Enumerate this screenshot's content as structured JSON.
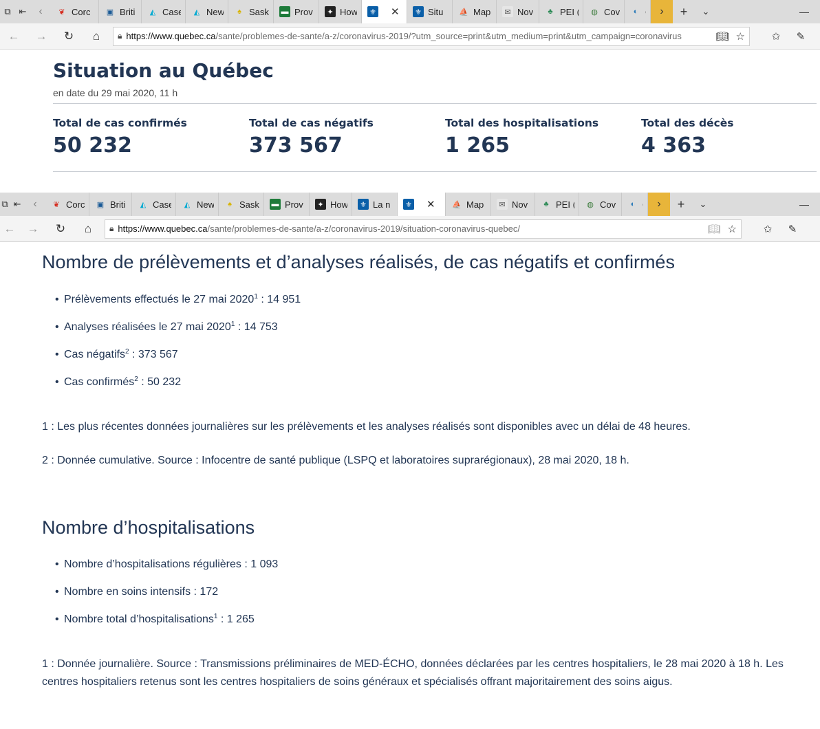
{
  "window1": {
    "tabs": [
      {
        "label": "Corc",
        "icon": "maple-leaf-icon",
        "active": false
      },
      {
        "label": "Briti",
        "icon": "bc-gov-icon",
        "active": false
      },
      {
        "label": "Case",
        "icon": "alberta-icon",
        "active": false
      },
      {
        "label": "New",
        "icon": "alberta-icon",
        "active": false
      },
      {
        "label": "Sask",
        "icon": "sask-icon",
        "active": false
      },
      {
        "label": "Prov",
        "icon": "manitoba-icon",
        "active": false
      },
      {
        "label": "How",
        "icon": "ontario-icon",
        "active": false
      },
      {
        "label": "",
        "icon": "quebec-fleur-icon",
        "active": true
      },
      {
        "label": "Situ",
        "icon": "quebec-fleur-icon",
        "active": false
      },
      {
        "label": "Map",
        "icon": "nb-icon",
        "active": false
      },
      {
        "label": "Nov",
        "icon": "ns-icon",
        "active": false
      },
      {
        "label": "PEI (",
        "icon": "pei-icon",
        "active": false
      },
      {
        "label": "Cov",
        "icon": "globe-icon",
        "active": false
      },
      {
        "label": "C",
        "icon": "nl-icon",
        "active": false
      }
    ],
    "url_domain": "https://www.quebec.ca",
    "url_path": "/sante/problemes-de-sante/a-z/coronavirus-2019/?utm_source=print&utm_medium=print&utm_campaign=coronavirus"
  },
  "situation": {
    "title": "Situation au Québec",
    "date": "en date du 29 mai 2020, 11 h",
    "stats": [
      {
        "label": "Total de cas confirmés",
        "value": "50 232"
      },
      {
        "label": "Total de cas négatifs",
        "value": "373 567"
      },
      {
        "label": "Total des hospitalisations",
        "value": "1 265"
      },
      {
        "label": "Total des décès",
        "value": "4 363"
      }
    ]
  },
  "window2": {
    "tabs": [
      {
        "label": "Corc",
        "icon": "maple-leaf-icon",
        "active": false
      },
      {
        "label": "Briti",
        "icon": "bc-gov-icon",
        "active": false
      },
      {
        "label": "Case",
        "icon": "alberta-icon",
        "active": false
      },
      {
        "label": "New",
        "icon": "alberta-icon",
        "active": false
      },
      {
        "label": "Sask",
        "icon": "sask-icon",
        "active": false
      },
      {
        "label": "Prov",
        "icon": "manitoba-icon",
        "active": false
      },
      {
        "label": "How",
        "icon": "ontario-icon",
        "active": false
      },
      {
        "label": "La n",
        "icon": "quebec-fleur-icon",
        "active": false
      },
      {
        "label": "",
        "icon": "quebec-fleur-icon",
        "active": true
      },
      {
        "label": "Map",
        "icon": "nb-icon",
        "active": false
      },
      {
        "label": "Nov",
        "icon": "ns-icon",
        "active": false
      },
      {
        "label": "PEI (",
        "icon": "pei-icon",
        "active": false
      },
      {
        "label": "Cov",
        "icon": "globe-icon",
        "active": false
      },
      {
        "label": "C",
        "icon": "nl-icon",
        "active": false
      }
    ],
    "url_domain": "https://www.quebec.ca",
    "url_path": "/sante/problemes-de-sante/a-z/coronavirus-2019/situation-coronavirus-quebec/"
  },
  "tests": {
    "heading": "Nombre de prélèvements et d’analyses réalisés, de cas négatifs et confirmés",
    "items": [
      {
        "text": "Prélèvements effectués le 27 mai 2020",
        "sup": "1",
        "value": " : 14 951"
      },
      {
        "text": "Analyses réalisées le 27 mai 2020",
        "sup": "1",
        "value": " : 14 753"
      },
      {
        "text": "Cas négatifs",
        "sup": "2",
        "value": " : 373 567"
      },
      {
        "text": "Cas confirmés",
        "sup": "2",
        "value": " : 50 232"
      }
    ],
    "note1": "1 : Les plus récentes données journalières sur les prélèvements et les analyses réalisés sont disponibles avec un délai de 48 heures.",
    "note2": "2 : Donnée cumulative. Source : Infocentre de santé publique (LSPQ et laboratoires suprarégionaux), 28 mai 2020, 18 h."
  },
  "hosp": {
    "heading": "Nombre d’hospitalisations",
    "items": [
      {
        "text": "Nombre d’hospitalisations régulières : 1 093",
        "sup": "",
        "value": ""
      },
      {
        "text": "Nombre en soins intensifs : 172",
        "sup": "",
        "value": ""
      },
      {
        "text": "Nombre total d’hospitalisations",
        "sup": "1",
        "value": " : 1 265"
      }
    ],
    "note": "1 : Donnée journalière. Source : Transmissions préliminaires de MED-ÉCHO, données déclarées par les centres hospitaliers, le 28 mai 2020 à 18 h. Les centres hospitaliers retenus sont les centres hospitaliers de soins généraux et spécialisés offrant majoritairement des soins aigus."
  }
}
